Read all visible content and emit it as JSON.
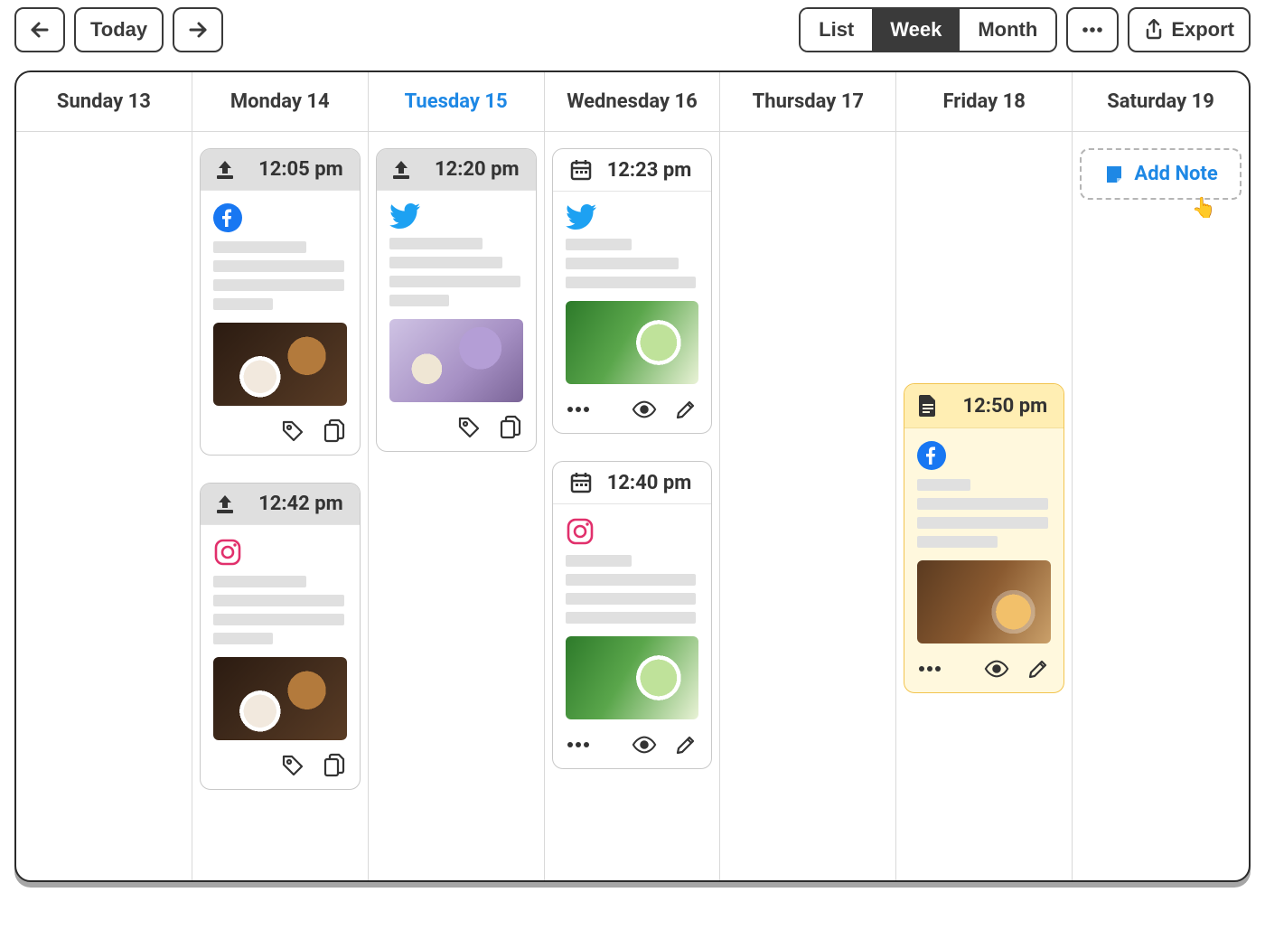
{
  "toolbar": {
    "today_label": "Today",
    "views": {
      "list": "List",
      "week": "Week",
      "month": "Month",
      "active": "week"
    },
    "export_label": "Export"
  },
  "days": [
    {
      "label": "Sunday 13",
      "today": false
    },
    {
      "label": "Monday 14",
      "today": false
    },
    {
      "label": "Tuesday 15",
      "today": true
    },
    {
      "label": "Wednesday 16",
      "today": false
    },
    {
      "label": "Thursday 17",
      "today": false
    },
    {
      "label": "Friday 18",
      "today": false
    },
    {
      "label": "Saturday 19",
      "today": false
    }
  ],
  "columns": [
    {
      "cards": []
    },
    {
      "cards": [
        {
          "status": "published",
          "icon": "upload-icon",
          "time": "12:05 pm",
          "platform": "facebook",
          "line_widths": [
            70,
            98,
            98,
            45
          ],
          "thumb": "coffee",
          "actions": [
            "tag",
            "copy"
          ]
        },
        {
          "status": "published",
          "icon": "upload-icon",
          "time": "12:42 pm",
          "platform": "instagram",
          "line_widths": [
            70,
            98,
            98,
            45
          ],
          "thumb": "coffee",
          "actions": [
            "tag",
            "copy"
          ]
        }
      ]
    },
    {
      "cards": [
        {
          "status": "published",
          "icon": "upload-icon",
          "time": "12:20 pm",
          "platform": "twitter",
          "line_widths": [
            70,
            85,
            98,
            45
          ],
          "thumb": "flowers",
          "actions": [
            "tag",
            "copy"
          ]
        }
      ]
    },
    {
      "cards": [
        {
          "status": "scheduled",
          "icon": "calendar-icon",
          "time": "12:23 pm",
          "platform": "twitter",
          "line_widths": [
            50,
            85,
            98
          ],
          "thumb": "matcha",
          "actions": [
            "more",
            "eye",
            "edit"
          ]
        },
        {
          "status": "scheduled",
          "icon": "calendar-icon",
          "time": "12:40 pm",
          "platform": "instagram",
          "line_widths": [
            50,
            98,
            98,
            98
          ],
          "thumb": "matcha",
          "actions": [
            "more",
            "eye",
            "edit"
          ]
        }
      ]
    },
    {
      "cards": []
    },
    {
      "cards": [
        {
          "status": "draft",
          "icon": "document-icon",
          "time": "12:50 pm",
          "platform": "facebook",
          "line_widths": [
            40,
            98,
            98,
            60
          ],
          "thumb": "drink",
          "actions": [
            "more",
            "eye",
            "edit"
          ]
        }
      ]
    },
    {
      "cards": [],
      "add_note": true
    }
  ],
  "add_note_label": "Add Note"
}
